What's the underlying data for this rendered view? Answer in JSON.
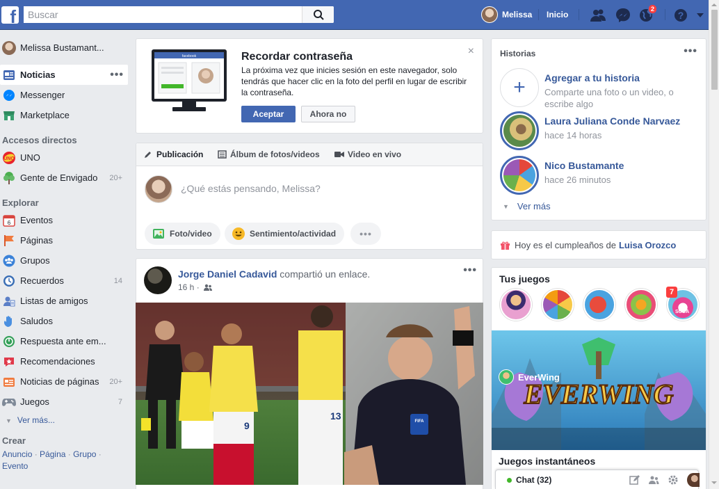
{
  "topbar": {
    "search_placeholder": "Buscar",
    "user_name": "Melissa",
    "home_label": "Inicio",
    "notifications_count": "2"
  },
  "leftnav": {
    "profile_name": "Melissa Bustamant...",
    "main_items": [
      {
        "label": "Noticias"
      },
      {
        "label": "Messenger"
      },
      {
        "label": "Marketplace"
      }
    ],
    "shortcuts_heading": "Accesos directos",
    "shortcuts": [
      {
        "label": "UNO",
        "count": ""
      },
      {
        "label": "Gente de Envigado",
        "count": "20+"
      }
    ],
    "explore_heading": "Explorar",
    "explore": [
      {
        "label": "Eventos",
        "count": ""
      },
      {
        "label": "Páginas",
        "count": ""
      },
      {
        "label": "Grupos",
        "count": ""
      },
      {
        "label": "Recuerdos",
        "count": "14"
      },
      {
        "label": "Listas de amigos",
        "count": ""
      },
      {
        "label": "Saludos",
        "count": ""
      },
      {
        "label": "Respuesta ante em...",
        "count": ""
      },
      {
        "label": "Recomendaciones",
        "count": ""
      },
      {
        "label": "Noticias de páginas",
        "count": "20+"
      },
      {
        "label": "Juegos",
        "count": "7"
      }
    ],
    "see_more": "Ver más...",
    "create_heading": "Crear",
    "create_links": [
      "Anuncio",
      "Página",
      "Grupo",
      "Evento"
    ]
  },
  "password_card": {
    "title": "Recordar contraseña",
    "text": "La próxima vez que inicies sesión en este navegador, solo tendrás que hacer clic en la foto del perfil en lugar de escribir la contraseña.",
    "accept_label": "Aceptar",
    "later_label": "Ahora no",
    "close_glyph": "×",
    "illustration_brand": "facebook"
  },
  "composer": {
    "tabs": [
      {
        "label": "Publicación"
      },
      {
        "label": "Álbum de fotos/videos"
      },
      {
        "label": "Video en vivo"
      }
    ],
    "placeholder": "¿Qué estás pensando, Melissa?",
    "actions": [
      {
        "label": "Foto/video"
      },
      {
        "label": "Sentimiento/actividad"
      }
    ]
  },
  "post": {
    "author": "Jorge Daniel Cadavid",
    "action": "compartió un enlace.",
    "time": "16 h ·"
  },
  "stories": {
    "heading": "Historias",
    "add_title": "Agregar a tu historia",
    "add_subtitle": "Comparte una foto o un video, o escribe algo",
    "items": [
      {
        "name": "Laura Juliana Conde Narvaez",
        "time": "hace 14 horas"
      },
      {
        "name": "Nico Bustamante",
        "time": "hace 26 minutos"
      }
    ],
    "see_more": "Ver más"
  },
  "birthday": {
    "text": "Hoy es el cumpleaños de",
    "name": "Luisa Orozco"
  },
  "games": {
    "heading": "Tus juegos",
    "badge": "7",
    "banner_title": "EVERWING",
    "banner_game": "EverWing",
    "instant_heading": "Juegos instantáneos",
    "candy_label": "SODA"
  },
  "chat": {
    "label": "Chat (32)"
  },
  "colors": {
    "brand": "#4267b2",
    "link": "#365899",
    "background": "#e9ebee",
    "online": "#42b72a",
    "alert": "#fa3e3e"
  }
}
